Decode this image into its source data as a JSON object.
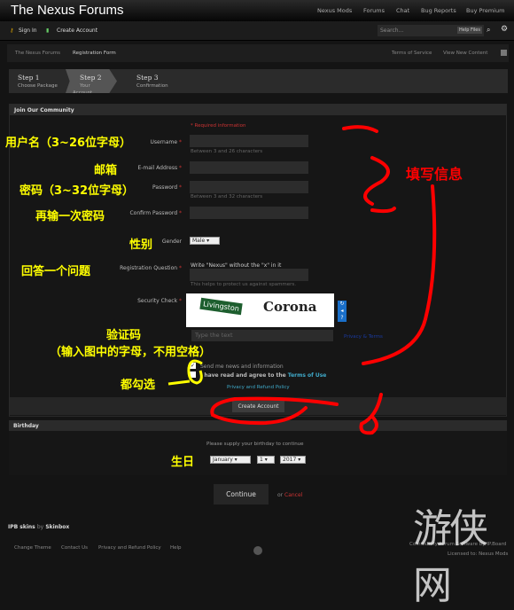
{
  "header": {
    "logo": "The Nexus Forums",
    "nav": [
      "Nexus Mods",
      "Forums",
      "Chat",
      "Bug Reports",
      "Buy Premium"
    ]
  },
  "toolbar": {
    "sign_in": "Sign In",
    "create_account": "Create Account",
    "search_placeholder": "Search...",
    "help_files": "Help Files"
  },
  "breadcrumb": {
    "items": [
      "The Nexus Forums",
      "Registration Form"
    ],
    "links": [
      "Terms of Service",
      "View New Content"
    ]
  },
  "steps": [
    {
      "title": "Step 1",
      "sub": "Choose Package"
    },
    {
      "title": "Step 2",
      "sub": "Your Account",
      "active": true
    },
    {
      "title": "Step 3",
      "sub": "Confirmation"
    }
  ],
  "form": {
    "section": "Join Our Community",
    "required": "* Required information",
    "username": "Username",
    "username_hint": "Between 3 and 26 characters",
    "email": "E-mail Address",
    "password": "Password",
    "password_hint": "Between 3 and 32 characters",
    "confirm": "Confirm Password",
    "gender": "Gender",
    "gender_value": "Male",
    "reg_question": "Registration Question",
    "reg_prompt": "Write \"Nexus\" without the \"x\" in it",
    "reg_hint": "This helps to protect us against spammers.",
    "security": "Security Check",
    "captcha_words": [
      "Livingston",
      "Corona"
    ],
    "captcha_placeholder": "Type the text",
    "captcha_privacy": "Privacy & Terms",
    "news": "Send me news and information",
    "news_checked": true,
    "agree_pre": "I have read and agree to the",
    "agree_link": "Terms of Use",
    "agree_checked": false,
    "privacy": "Privacy and Refund Policy",
    "submit": "Create Account"
  },
  "birthday": {
    "section": "Birthday",
    "prompt": "Please supply your birthday to continue",
    "month": "January",
    "day": "1",
    "year": "2017"
  },
  "actions": {
    "continue": "Continue",
    "or": "or",
    "cancel": "Cancel"
  },
  "footer": {
    "skin_a": "IPB skins",
    "skin_by": "by",
    "skin_b": "Skinbox",
    "links": [
      "Change Theme",
      "Contact Us",
      "Privacy and Refund Policy",
      "Help"
    ],
    "powered": "Community Forum Software by IP.Board",
    "licensed": "Licensed to: Nexus Mods",
    "watermark": "游侠网"
  },
  "annotations": {
    "username": "用户名（3~26位字母）",
    "email": "邮箱",
    "password": "密码（3~32位字母）",
    "confirm": "再输一次密码",
    "gender": "性别",
    "question": "回答一个问题",
    "captcha1": "验证码",
    "captcha2": "（输入图中的字母，不用空格）",
    "check": "都勾选",
    "fill": "填写信息",
    "birthday": "生日"
  },
  "colors": {
    "annotation_text": "#ffff00",
    "annotation_marks": "#ff0000",
    "required": "#cc3333",
    "link": "#3fa9c9"
  }
}
